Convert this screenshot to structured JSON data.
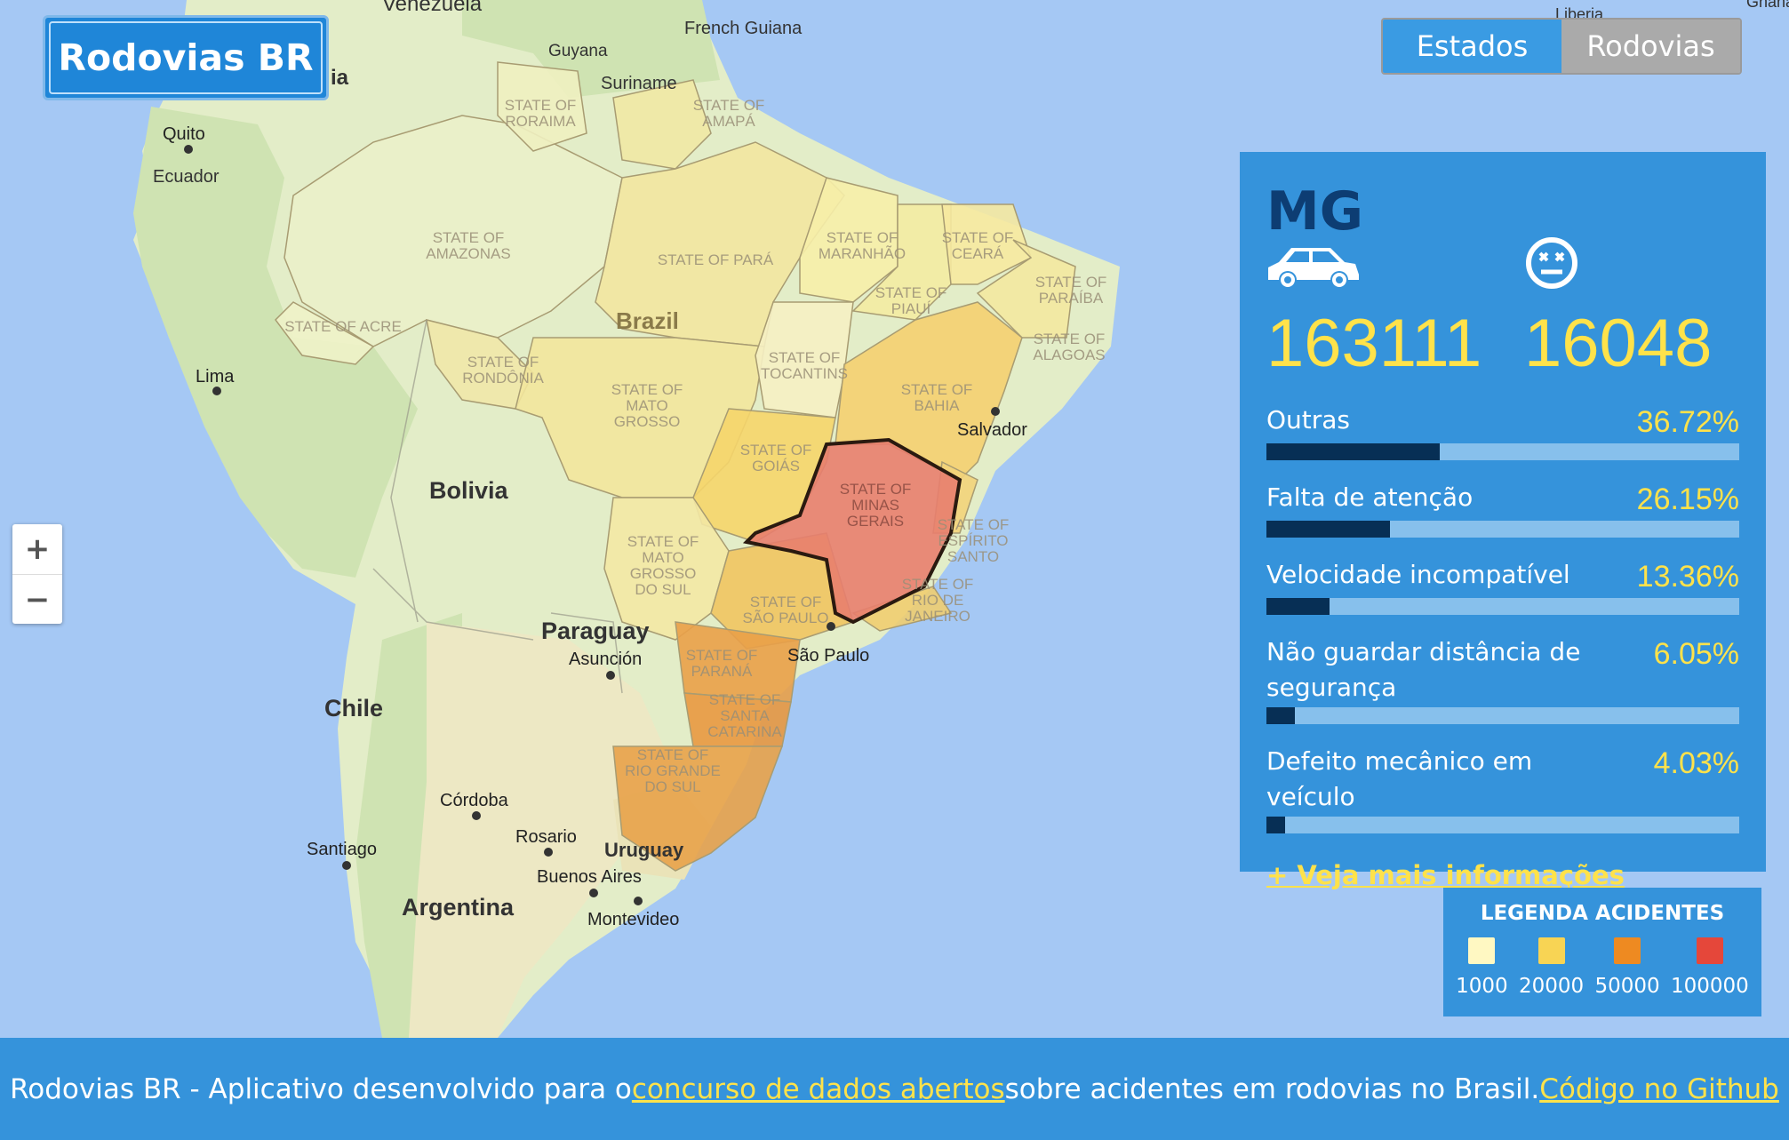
{
  "app": {
    "logo": "Rodovias BR"
  },
  "toggle": {
    "estados": "Estados",
    "rodovias": "Rodovias"
  },
  "zoom": {
    "in": "+",
    "out": "−"
  },
  "map": {
    "countries": [
      "Venezuela",
      "Guyana",
      "French Guiana",
      "Suriname",
      "Ecuador",
      "Brazil",
      "Bolivia",
      "Paraguay",
      "Chile",
      "Argentina",
      "Uruguay",
      "Liberia",
      "Ghana",
      "ia"
    ],
    "cities": [
      "Quito",
      "Lima",
      "Asunción",
      "Córdoba",
      "Rosario",
      "Santiago",
      "Buenos Aires",
      "Montevideo",
      "São Paulo",
      "Salvador"
    ],
    "states": [
      [
        "STATE OF",
        "RORAIMA"
      ],
      [
        "STATE OF",
        "AMAPÁ"
      ],
      [
        "STATE OF",
        "AMAZONAS"
      ],
      [
        "STATE OF PARÁ"
      ],
      [
        "STATE OF",
        "MARANHÃO"
      ],
      [
        "STATE OF",
        "CEARÁ"
      ],
      [
        "STATE OF",
        "PARAÍBA"
      ],
      [
        "STATE OF",
        "PIAUÍ"
      ],
      [
        "STATE OF",
        "ALAGOAS"
      ],
      [
        "STATE OF ACRE"
      ],
      [
        "STATE OF",
        "RONDÔNIA"
      ],
      [
        "STATE OF",
        "TOCANTINS"
      ],
      [
        "STATE OF",
        "BAHIA"
      ],
      [
        "STATE OF",
        "MATO",
        "GROSSO"
      ],
      [
        "STATE OF",
        "GOIÁS"
      ],
      [
        "STATE OF",
        "MINAS",
        "GERAIS"
      ],
      [
        "STATE OF",
        "ESPÍRITO",
        "SANTO"
      ],
      [
        "STATE OF",
        "MATO",
        "GROSSO",
        "DO SUL"
      ],
      [
        "STATE OF",
        "SÃO PAULO"
      ],
      [
        "STATE OF",
        "RIO DE",
        "JANEIRO"
      ],
      [
        "STATE OF",
        "PARANÁ"
      ],
      [
        "STATE OF",
        "SANTA",
        "CATARINA"
      ],
      [
        "STATE OF",
        "RIO GRANDE",
        "DO SUL"
      ]
    ]
  },
  "panel": {
    "state": "MG",
    "car_icon": "car-icon",
    "death_icon": "dead-face-icon",
    "accidents": "163111",
    "deaths": "16048",
    "causes": [
      {
        "label": "Outras",
        "pct": "36.72%",
        "value": 0.3672
      },
      {
        "label": "Falta de atenção",
        "pct": "26.15%",
        "value": 0.2615
      },
      {
        "label": "Velocidade incompatível",
        "pct": "13.36%",
        "value": 0.1336
      },
      {
        "label": "Não guardar distância de segurança",
        "pct": "6.05%",
        "value": 0.0605
      },
      {
        "label": "Defeito mecânico em veículo",
        "pct": "4.03%",
        "value": 0.0403
      }
    ],
    "more_link": "+ Veja mais informações"
  },
  "legend": {
    "title": "LEGENDA ACIDENTES",
    "items": [
      {
        "label": "1000",
        "color": "#fff8c2"
      },
      {
        "label": "20000",
        "color": "#f8d454"
      },
      {
        "label": "50000",
        "color": "#ee8a21"
      },
      {
        "label": "100000",
        "color": "#e5473a"
      }
    ]
  },
  "footer": {
    "text1": "Rodovias BR - Aplicativo desenvolvido para o ",
    "link1": "concurso de dados abertos",
    "text2": " sobre acidentes em rodovias no Brasil. ",
    "link2": "Código no Github"
  },
  "colors": {
    "accent": "#3593db",
    "highlight": "#ffe24a",
    "selected_state": "#e87e6e"
  }
}
